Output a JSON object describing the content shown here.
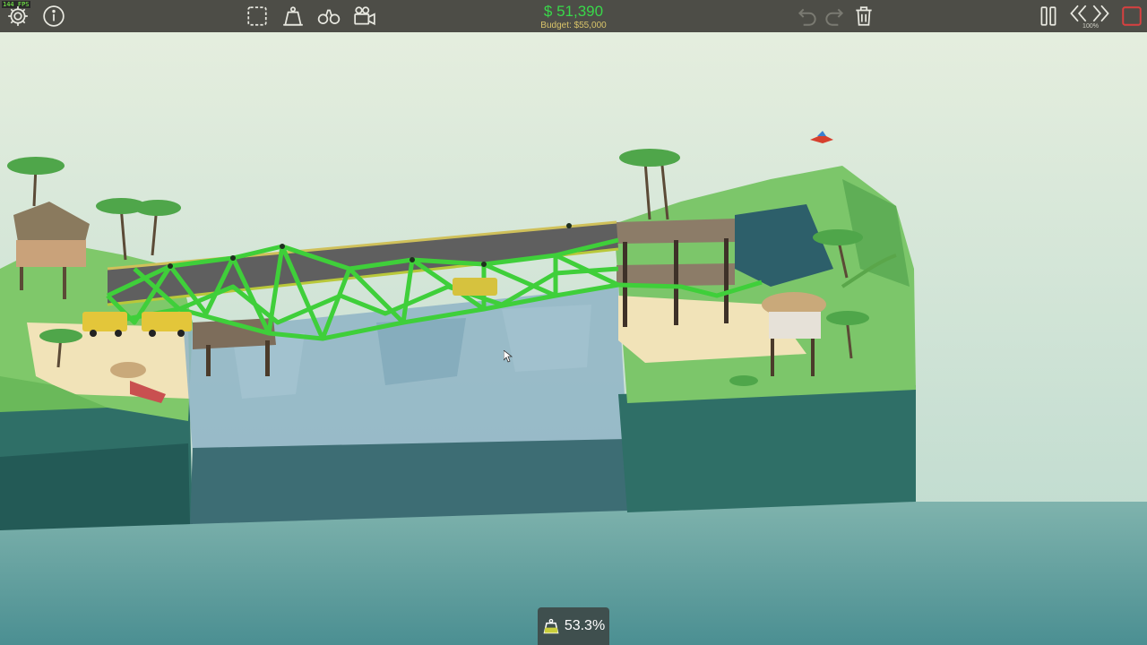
{
  "hud": {
    "fps_text": "144 FPS",
    "money": "$ 51,390",
    "budget": "Budget: $55,000",
    "speed": "100%"
  },
  "stress": {
    "value": "53.3%"
  },
  "colors": {
    "toolbar": "#4d4d47",
    "money": "#39d84a",
    "budget": "#d9c46a",
    "bridge_green": "#3fcf3a",
    "water": "#5f9aa0",
    "sky": "#dfeadf"
  },
  "icons": {
    "settings": "gear-icon",
    "info": "info-icon",
    "select": "select-box-icon",
    "weight": "weight-icon",
    "view": "binoculars-icon",
    "camera": "camera-icon",
    "undo": "undo-icon",
    "redo": "redo-icon",
    "delete": "trash-icon",
    "pause": "pause-icon",
    "slower": "rewind-icon",
    "faster": "fast-forward-icon",
    "stop": "stop-icon",
    "stress": "weight-stress-icon"
  }
}
